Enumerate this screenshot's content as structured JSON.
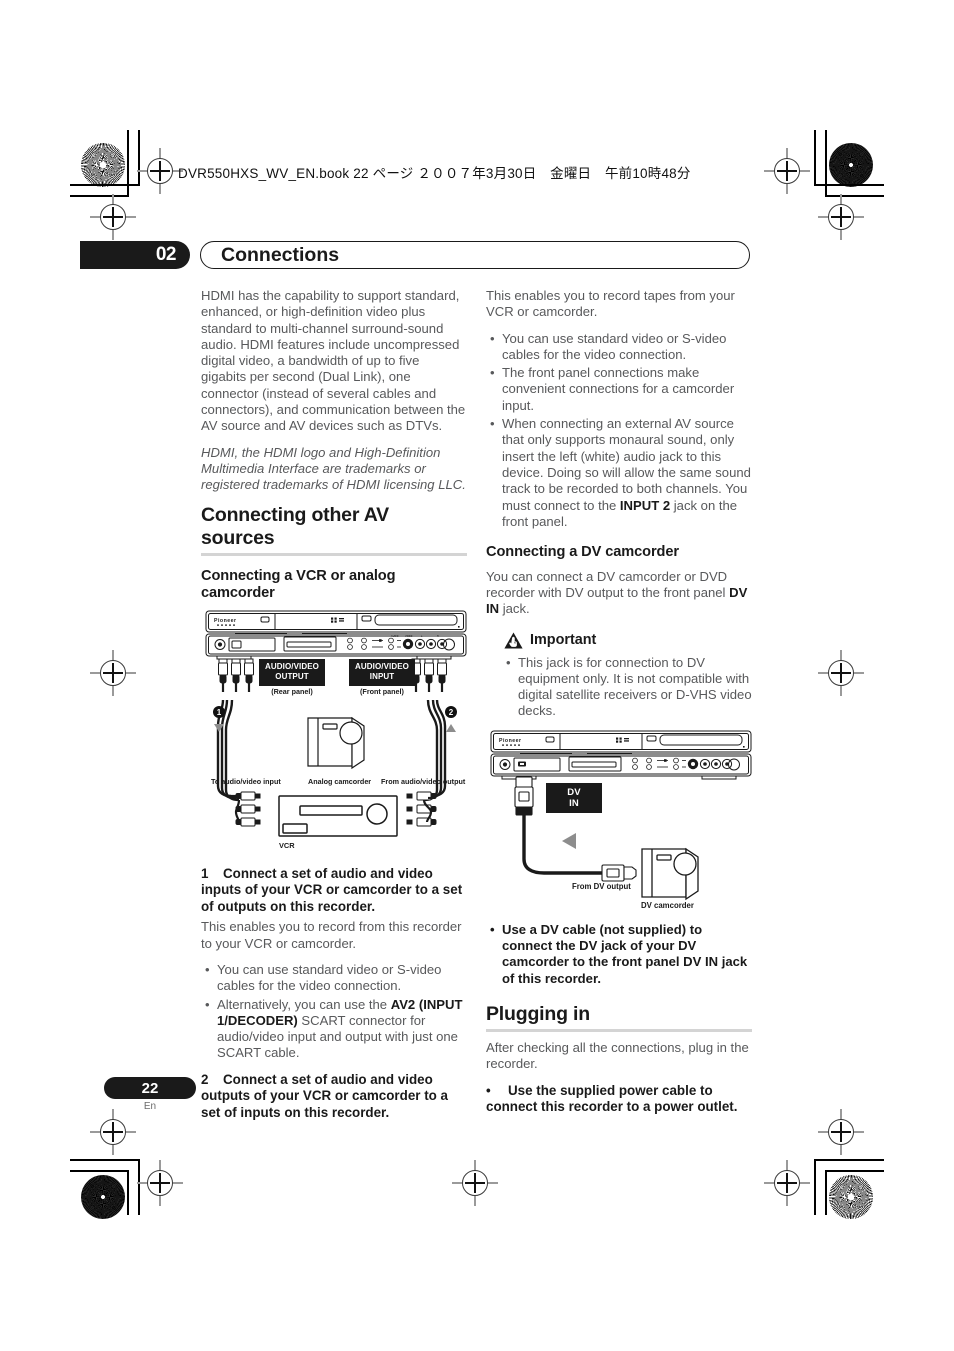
{
  "header": {
    "slug": "DVR550HXS_WV_EN.book 22 ページ ２００７年3月30日　金曜日　午前10時48分"
  },
  "chapter": {
    "number": "02",
    "title": "Connections"
  },
  "left_column": {
    "hdmi_paragraph": "HDMI has the capability to support standard, enhanced, or high-definition video plus standard to multi-channel surround-sound audio. HDMI features include uncompressed digital video, a bandwidth of up to five gigabits per second (Dual Link), one connector (instead of several cables and connectors), and communication between the AV source and AV devices such as DTVs.",
    "hdmi_trademark": "HDMI, the HDMI logo and High-Definition Multimedia Interface are trademarks or registered trademarks of HDMI licensing LLC.",
    "section_heading": "Connecting other AV sources",
    "subheading": "Connecting a VCR or analog camcorder",
    "figure": {
      "label_output": "AUDIO/VIDEO",
      "label_output2": "OUTPUT",
      "label_output_panel": "(Rear panel)",
      "label_input": "AUDIO/VIDEO",
      "label_input2": "INPUT",
      "label_input_panel": "(Front panel)",
      "marker_1": "❶",
      "marker_2": "❷",
      "label_to_av_input": "To audio/video input",
      "label_from_av_output": "From audio/video output",
      "label_analog_camcorder": "Analog camcorder",
      "label_vcr": "VCR"
    },
    "step1_number": "1",
    "step1_text": "Connect a set of audio and video inputs of your VCR or camcorder to a set of outputs on this recorder.",
    "step1_para": "This enables you to record from this recorder to your VCR or camcorder.",
    "step1_bullets": [
      {
        "pre": "You can use standard video or S-video cables for the video connection.",
        "bold": "",
        "post": ""
      },
      {
        "pre": "Alternatively, you can use the ",
        "bold": "AV2 (INPUT 1/DECODER)",
        "post": " SCART connector for audio/video input and output with just one SCART cable."
      }
    ],
    "step2_number": "2",
    "step2_text": "Connect a set of audio and video outputs of your VCR or camcorder to a set of inputs on this recorder."
  },
  "right_column": {
    "intro_para": "This enables you to record tapes from your VCR or camcorder.",
    "intro_bullets": [
      {
        "pre": "You can use standard video or S-video cables for the video connection.",
        "bold": "",
        "post": ""
      },
      {
        "pre": "The front panel connections make convenient connections for a camcorder input.",
        "bold": "",
        "post": ""
      },
      {
        "pre": "When connecting an external AV source that only supports monaural sound, only insert the left (white) audio jack to this device. Doing so will allow the same sound track to be recorded to both channels. You must connect to the ",
        "bold": "INPUT 2",
        "post": " jack on the front panel."
      }
    ],
    "dv_heading": "Connecting a DV camcorder",
    "dv_para_pre": "You can connect a DV camcorder or DVD recorder with DV output to the front panel ",
    "dv_para_bold": "DV IN",
    "dv_para_post": " jack.",
    "important_label": "Important",
    "important_bullets": [
      {
        "pre": "This jack is for connection to DV equipment only. It is not compatible with digital satellite receivers or D-VHS video decks.",
        "bold": "",
        "post": ""
      }
    ],
    "dv_figure": {
      "label_dv": "DV",
      "label_in": "IN",
      "label_from_dv_output": "From DV output",
      "label_dv_camcorder": "DV camcorder"
    },
    "dv_use_bullet": "Use a DV cable (not supplied) to connect the DV jack of your DV camcorder to the front panel DV IN jack of this recorder.",
    "plugging_heading": "Plugging in",
    "plugging_para": "After checking all the connections, plug in the recorder.",
    "plugging_bullet_marker": "•",
    "plugging_bullet": "Use the supplied power cable to connect this recorder to a power outlet."
  },
  "footer": {
    "page_number": "22",
    "language": "En"
  },
  "colors": {
    "ink_dark": "#1a1a1a",
    "body_gray": "#58595b",
    "rule_gray": "#d4d4d4"
  }
}
